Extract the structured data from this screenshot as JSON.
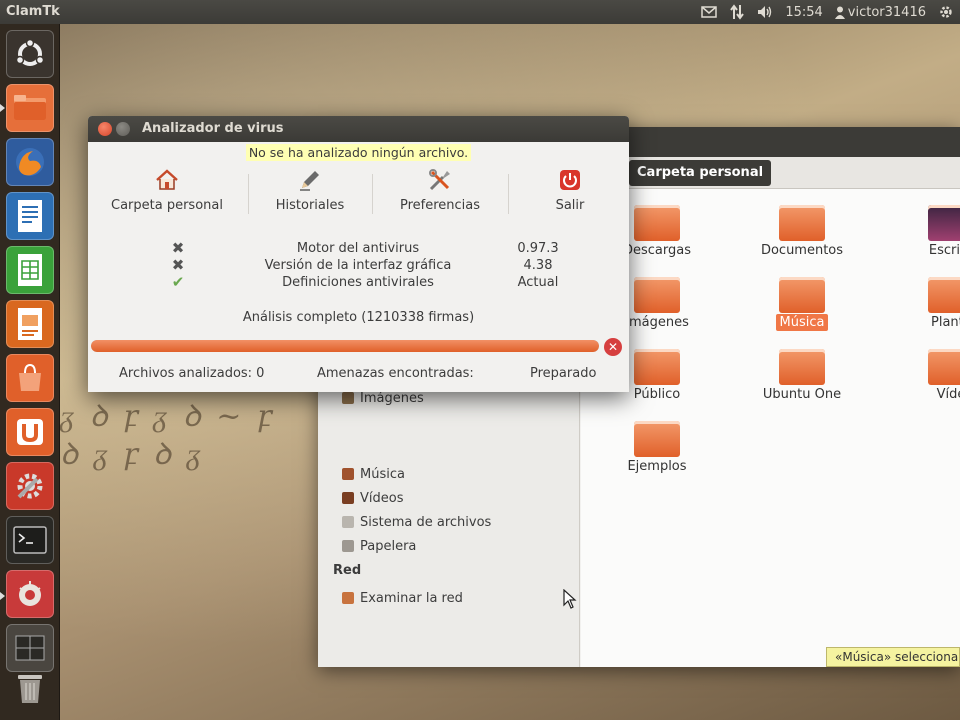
{
  "top_panel": {
    "app_name": "ClamTk",
    "clock": "15:54",
    "user": "victor31416"
  },
  "launcher": {
    "items": [
      {
        "name": "dash-home",
        "icon": "ubuntu-logo-icon",
        "color": "#3a342e"
      },
      {
        "name": "home-folder",
        "icon": "folder-icon",
        "color": "#e66f3a"
      },
      {
        "name": "firefox",
        "icon": "firefox-icon",
        "color": "#3a6fb8"
      },
      {
        "name": "writer",
        "icon": "libreoffice-writer-icon",
        "color": "#2d6fb4"
      },
      {
        "name": "calc",
        "icon": "libreoffice-calc-icon",
        "color": "#3aa23a"
      },
      {
        "name": "impress",
        "icon": "libreoffice-impress-icon",
        "color": "#d9681f"
      },
      {
        "name": "software-center",
        "icon": "shopping-bag-icon",
        "color": "#e0602a"
      },
      {
        "name": "ubuntu-one",
        "icon": "ubuntu-one-icon",
        "color": "#e0602a"
      },
      {
        "name": "system-settings",
        "icon": "gear-wrench-icon",
        "color": "#c9392a"
      },
      {
        "name": "terminal",
        "icon": "terminal-icon",
        "color": "#3c3b37"
      },
      {
        "name": "clamtk",
        "icon": "virus-scanner-icon",
        "color": "#c83a3a"
      },
      {
        "name": "workspaces",
        "icon": "workspace-switcher-icon",
        "color": "#5a5550"
      },
      {
        "name": "trash",
        "icon": "trash-icon",
        "color": "#6b6660"
      }
    ]
  },
  "nautilus": {
    "path_button": "Carpeta personal",
    "sidebar": {
      "places": [
        "Imágenes",
        "Música",
        "Vídeos",
        "Sistema de archivos",
        "Papelera"
      ],
      "network_heading": "Red",
      "network": [
        "Examinar la red"
      ]
    },
    "folders": [
      {
        "label": "Descargas",
        "emblem": "download-arrow"
      },
      {
        "label": "Documentos",
        "emblem": "document"
      },
      {
        "label": "Escrito",
        "emblem": "desktop"
      },
      {
        "label": "Imágenes",
        "emblem": "camera"
      },
      {
        "label": "Música",
        "emblem": "music-note",
        "selected": true
      },
      {
        "label": "Plantil",
        "emblem": "template"
      },
      {
        "label": "Público",
        "emblem": "share"
      },
      {
        "label": "Ubuntu One",
        "emblem": "check"
      },
      {
        "label": "Víde",
        "emblem": "film"
      },
      {
        "label": "Ejemplos",
        "emblem": "link-arrow"
      }
    ],
    "status_tip": "«Música» selecciona"
  },
  "dialog": {
    "title": "Analizador de virus",
    "status_message": "No se ha analizado ningún archivo.",
    "toolbar": [
      {
        "label": "Carpeta personal",
        "icon": "home-icon"
      },
      {
        "label": "Historiales",
        "icon": "pencil-icon"
      },
      {
        "label": "Preferencias",
        "icon": "tools-icon"
      },
      {
        "label": "Salir",
        "icon": "power-icon"
      }
    ],
    "info": [
      {
        "status": "x",
        "label": "Motor del antivirus",
        "value": "0.97.3"
      },
      {
        "status": "x",
        "label": "Versión de la interfaz gráfica",
        "value": "4.38"
      },
      {
        "status": "ok",
        "label": "Definiciones antivirales",
        "value": "Actual"
      }
    ],
    "scan_summary": "Análisis completo (1210338 firmas)",
    "progress": 1.0,
    "footer": {
      "files_scanned": "Archivos analizados: 0",
      "threats": "Amenazas encontradas:",
      "state": "Preparado"
    },
    "colors": {
      "accent": "#e0602a",
      "ok": "#6aa84f",
      "error": "#d63f3f"
    }
  }
}
